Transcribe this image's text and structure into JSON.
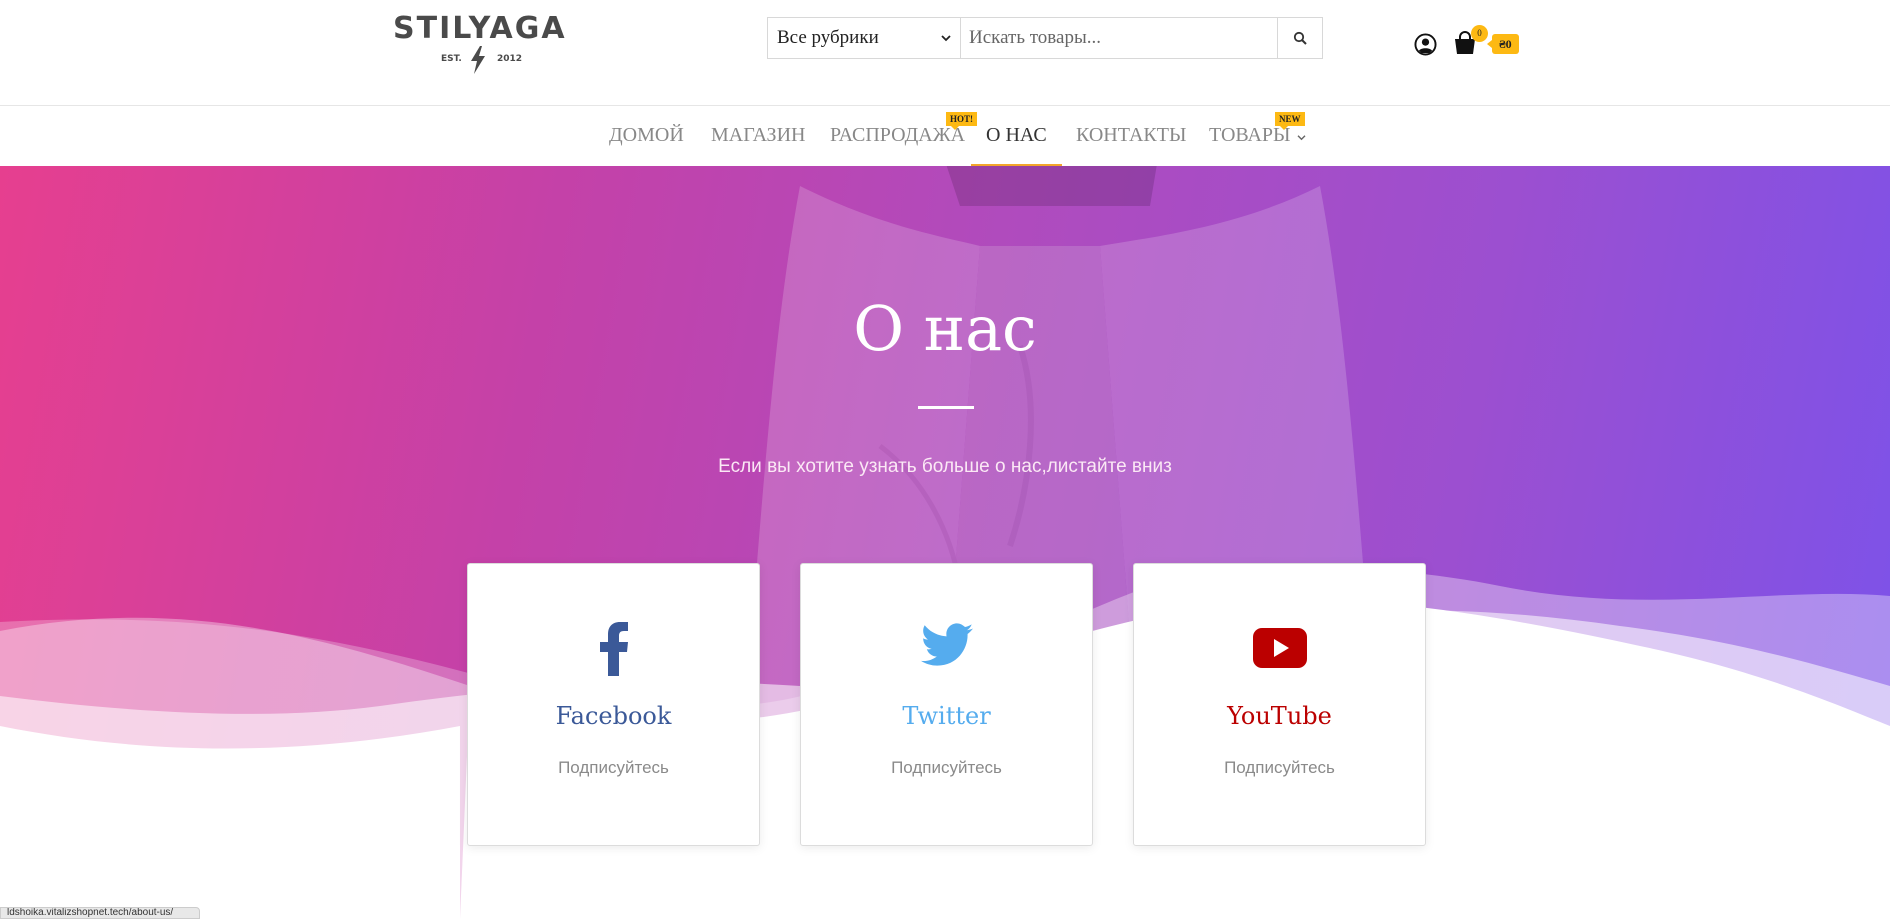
{
  "header": {
    "logo": {
      "word": "STILYAGA",
      "est": "EST.",
      "year": "2012"
    },
    "search": {
      "category_selected": "Все рубрики",
      "placeholder": "Искать товары..."
    },
    "cart": {
      "count": "0",
      "total": "₴0"
    }
  },
  "nav": {
    "items": [
      {
        "label": "ДОМОЙ"
      },
      {
        "label": "МАГАЗИН"
      },
      {
        "label": "РАСПРОДАЖА",
        "badge": "HOT!"
      },
      {
        "label": "О НАС"
      },
      {
        "label": "КОНТАКТЫ"
      },
      {
        "label": "ТОВАРЫ",
        "badge": "NEW"
      }
    ],
    "active_index": 3
  },
  "hero": {
    "title": "О нас",
    "subtitle": "Если вы хотите узнать больше о нас,листайте вниз"
  },
  "cards": [
    {
      "title": "Facebook",
      "subtitle": "Подписуйтесь",
      "icon": "facebook-icon",
      "color": "#3b5998"
    },
    {
      "title": "Twitter",
      "subtitle": "Подписуйтесь",
      "icon": "twitter-icon",
      "color": "#55acee"
    },
    {
      "title": "YouTube",
      "subtitle": "Подписуйтесь",
      "icon": "youtube-icon",
      "color": "#bb0000"
    }
  ],
  "status_bar": {
    "url": "ldshoika.vitalizshopnet.tech/about-us/"
  },
  "colors": {
    "accent": "#fdb913",
    "text": "#4a4a4a"
  }
}
